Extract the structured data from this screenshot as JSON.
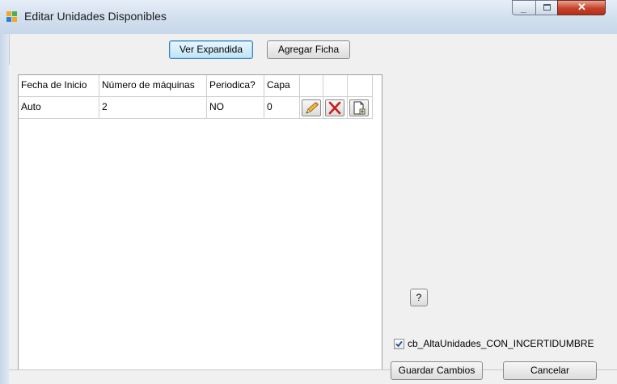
{
  "window": {
    "title": "Editar Unidades Disponibles",
    "controls": {
      "minimize": "minimize-icon",
      "maximize": "maximize-icon",
      "close": "close-icon"
    }
  },
  "toolbar": {
    "expand_label": "Ver Expandida",
    "add_label": "Agregar Ficha"
  },
  "table": {
    "columns": [
      "Fecha de Inicio",
      "Número de máquinas",
      "Periodica?",
      "Capa"
    ],
    "rows": [
      {
        "fecha": "Auto",
        "maquinas": "2",
        "periodica": "NO",
        "capa": "0",
        "actions": [
          "edit-pencil-icon",
          "delete-x-icon",
          "copy-document-icon"
        ]
      }
    ]
  },
  "side": {
    "help_label": "?",
    "checkbox_label": "cb_AltaUnidades_CON_INCERTIDUMBRE",
    "checkbox_checked": true
  },
  "footer": {
    "save_label": "Guardar Cambios",
    "cancel_label": "Cancelar"
  },
  "colors": {
    "titlebar": "#d2dfee",
    "close_button": "#c7402a",
    "focus_border": "#3c7fb1",
    "delete_icon": "#cc1b1b"
  }
}
